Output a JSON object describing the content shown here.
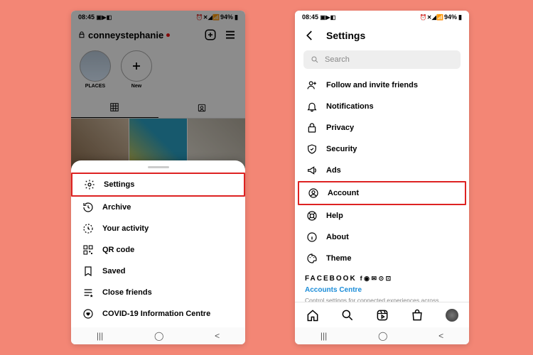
{
  "status": {
    "time": "08:45",
    "left_icons": "▣ ▶ ◧",
    "right_icons": "⏰ ✕ ◢ 📶",
    "battery": "94%"
  },
  "left": {
    "username": "conneystephanie",
    "highlights": [
      {
        "label": "PLACES",
        "kind": "places"
      },
      {
        "label": "New",
        "kind": "new"
      }
    ],
    "sheet": [
      {
        "icon": "gear-icon",
        "label": "Settings",
        "highlighted": true
      },
      {
        "icon": "clock-history-icon",
        "label": "Archive",
        "highlighted": false
      },
      {
        "icon": "activity-icon",
        "label": "Your activity",
        "highlighted": false
      },
      {
        "icon": "qr-code-icon",
        "label": "QR code",
        "highlighted": false
      },
      {
        "icon": "bookmark-icon",
        "label": "Saved",
        "highlighted": false
      },
      {
        "icon": "list-star-icon",
        "label": "Close friends",
        "highlighted": false
      },
      {
        "icon": "covid-heart-icon",
        "label": "COVID-19 Information Centre",
        "highlighted": false
      }
    ]
  },
  "right": {
    "title": "Settings",
    "search_placeholder": "Search",
    "items": [
      {
        "icon": "add-friend-icon",
        "label": "Follow and invite friends",
        "highlighted": false
      },
      {
        "icon": "bell-icon",
        "label": "Notifications",
        "highlighted": false
      },
      {
        "icon": "lock-icon",
        "label": "Privacy",
        "highlighted": false
      },
      {
        "icon": "shield-icon",
        "label": "Security",
        "highlighted": false
      },
      {
        "icon": "megaphone-icon",
        "label": "Ads",
        "highlighted": false
      },
      {
        "icon": "person-circle-icon",
        "label": "Account",
        "highlighted": true
      },
      {
        "icon": "life-ring-icon",
        "label": "Help",
        "highlighted": false
      },
      {
        "icon": "info-icon",
        "label": "About",
        "highlighted": false
      },
      {
        "icon": "palette-icon",
        "label": "Theme",
        "highlighted": false
      }
    ],
    "fb_title": "FACEBOOK",
    "fb_glyphs": "f ◉ ✉ ⊙ ⊡",
    "ac_link": "Accounts Centre",
    "fb_desc": "Control settings for connected experiences across Instagram, the Facebook app and Messenger,"
  }
}
